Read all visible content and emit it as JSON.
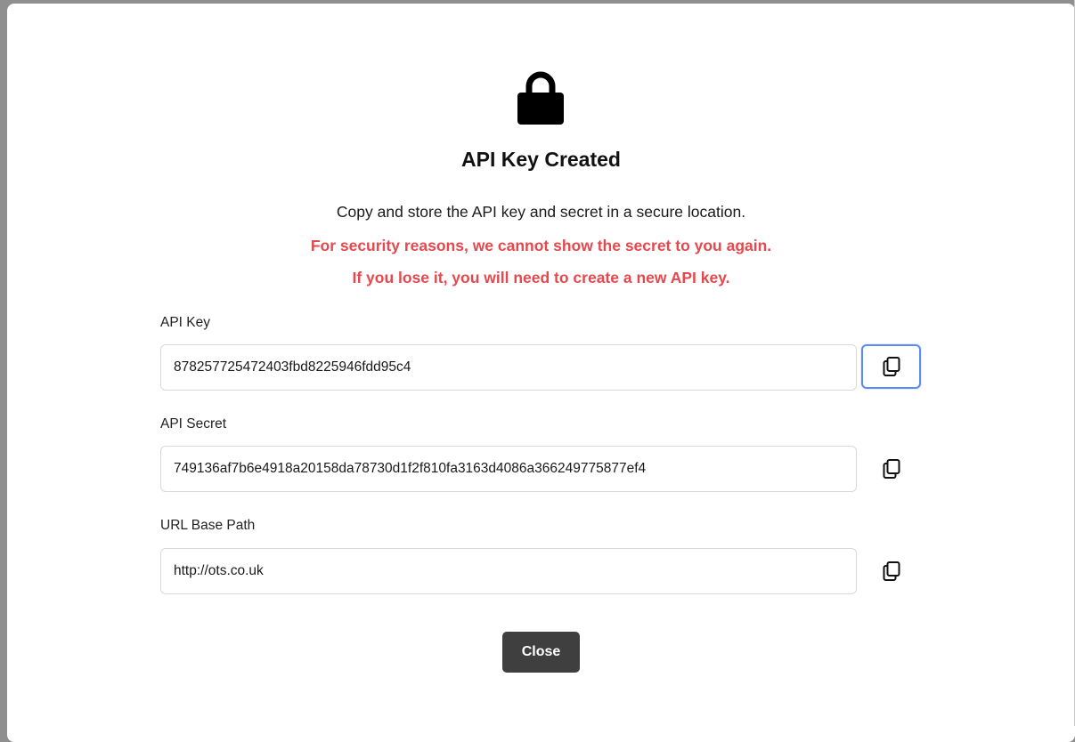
{
  "dialog": {
    "icon": "lock-icon",
    "title": "API Key Created",
    "description": "Copy and store the API key and secret in a secure location.",
    "warning_line1": "For security reasons, we cannot show the secret to you again.",
    "warning_line2": "If you lose it, you will need to create a new API key.",
    "warning_color": "#e5484d",
    "fields": [
      {
        "label": "API Key",
        "value": "878257725472403fbd8225946fdd95c4",
        "copy_icon": "copy-icon"
      },
      {
        "label": "API Secret",
        "value": "749136af7b6e4918a20158da78730d1f2f810fa3163d4086a366249775877ef4",
        "copy_icon": "copy-icon"
      },
      {
        "label": "URL Base Path",
        "value": "http://ots.co.uk",
        "copy_icon": "copy-icon"
      }
    ],
    "close_label": "Close",
    "close_color": "#3f3f3f",
    "focus_color": "#5b8def"
  }
}
